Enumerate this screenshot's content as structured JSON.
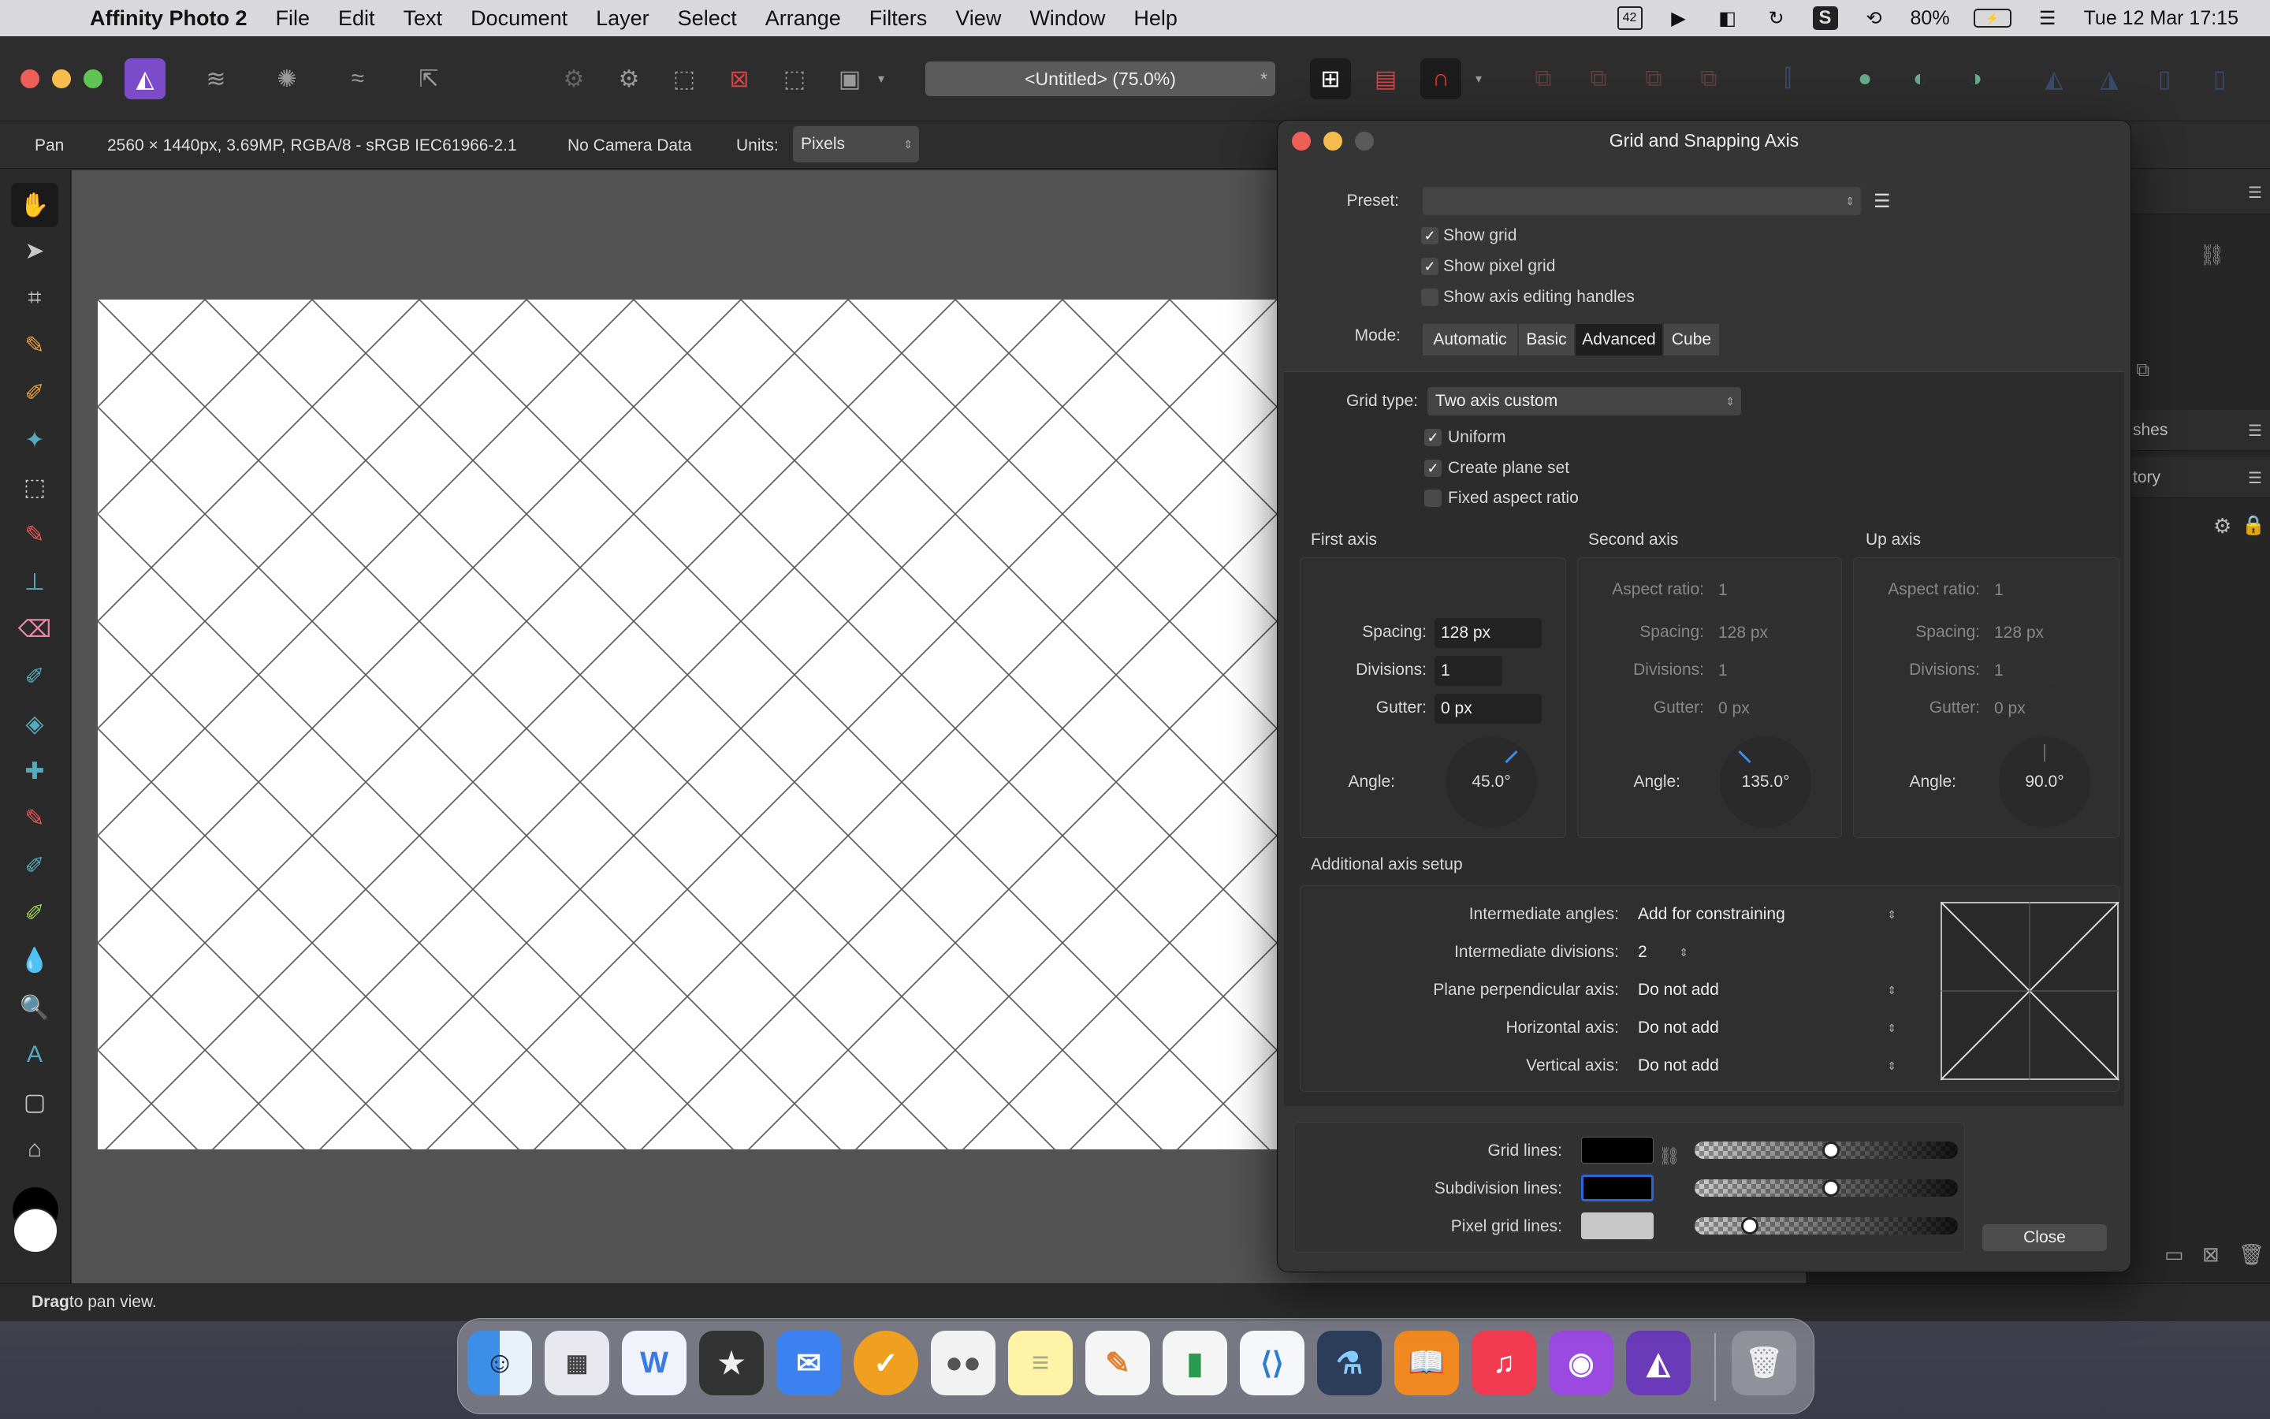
{
  "menubar": {
    "app": "Affinity Photo 2",
    "items": [
      "File",
      "Edit",
      "Text",
      "Document",
      "Layer",
      "Select",
      "Arrange",
      "Filters",
      "View",
      "Window",
      "Help"
    ],
    "battery": "80%",
    "datetime": "Tue 12 Mar  17:15",
    "calendar_badge": "42"
  },
  "document": {
    "title": "<Untitled> (75.0%)",
    "star": "*"
  },
  "context": {
    "tool": "Pan",
    "info": "2560 × 1440px, 3.69MP, RGBA/8 - sRGB IEC61966-2.1",
    "camera": "No Camera Data",
    "units_label": "Units:",
    "units_value": "Pixels"
  },
  "status": {
    "bold": "Drag",
    "rest": " to pan view."
  },
  "panels": {
    "brushes": "shes",
    "history": "tory"
  },
  "dialog": {
    "title": "Grid and Snapping Axis",
    "preset_label": "Preset:",
    "preset_value": "",
    "show_grid": "Show grid",
    "show_pixel_grid": "Show pixel grid",
    "show_axis_handles": "Show axis editing handles",
    "mode_label": "Mode:",
    "modes": [
      "Automatic",
      "Basic",
      "Advanced",
      "Cube"
    ],
    "grid_type_label": "Grid type:",
    "grid_type_value": "Two axis custom",
    "uniform": "Uniform",
    "create_plane_set": "Create plane set",
    "fixed_aspect": "Fixed aspect ratio",
    "axes": [
      {
        "title": "First axis",
        "spacing": "128 px",
        "divisions": "1",
        "gutter": "0 px",
        "angle": "45.0°"
      },
      {
        "title": "Second axis",
        "aspect": "1",
        "spacing": "128 px",
        "divisions": "1",
        "gutter": "0 px",
        "angle": "135.0°"
      },
      {
        "title": "Up axis",
        "aspect": "1",
        "spacing": "128 px",
        "divisions": "1",
        "gutter": "0 px",
        "angle": "90.0°"
      }
    ],
    "labels": {
      "aspect": "Aspect ratio:",
      "spacing": "Spacing:",
      "divisions": "Divisions:",
      "gutter": "Gutter:",
      "angle": "Angle:"
    },
    "additional_title": "Additional axis setup",
    "intermediate_angles_label": "Intermediate angles:",
    "intermediate_angles_value": "Add for constraining",
    "intermediate_divisions_label": "Intermediate divisions:",
    "intermediate_divisions_value": "2",
    "plane_perp_label": "Plane perpendicular axis:",
    "plane_perp_value": "Do not add",
    "horizontal_label": "Horizontal axis:",
    "horizontal_value": "Do not add",
    "vertical_label": "Vertical axis:",
    "vertical_value": "Do not add",
    "grid_lines_label": "Grid lines:",
    "subdivision_lines_label": "Subdivision lines:",
    "pixel_grid_lines_label": "Pixel grid lines:",
    "close": "Close",
    "colors": {
      "grid": "#000000",
      "subdivision": "#000000",
      "pixel": "#c8c8c8",
      "accent": "#2a66d9"
    },
    "opacity": {
      "grid": 0.52,
      "subdivision": 0.52,
      "pixel": 0.19
    }
  }
}
